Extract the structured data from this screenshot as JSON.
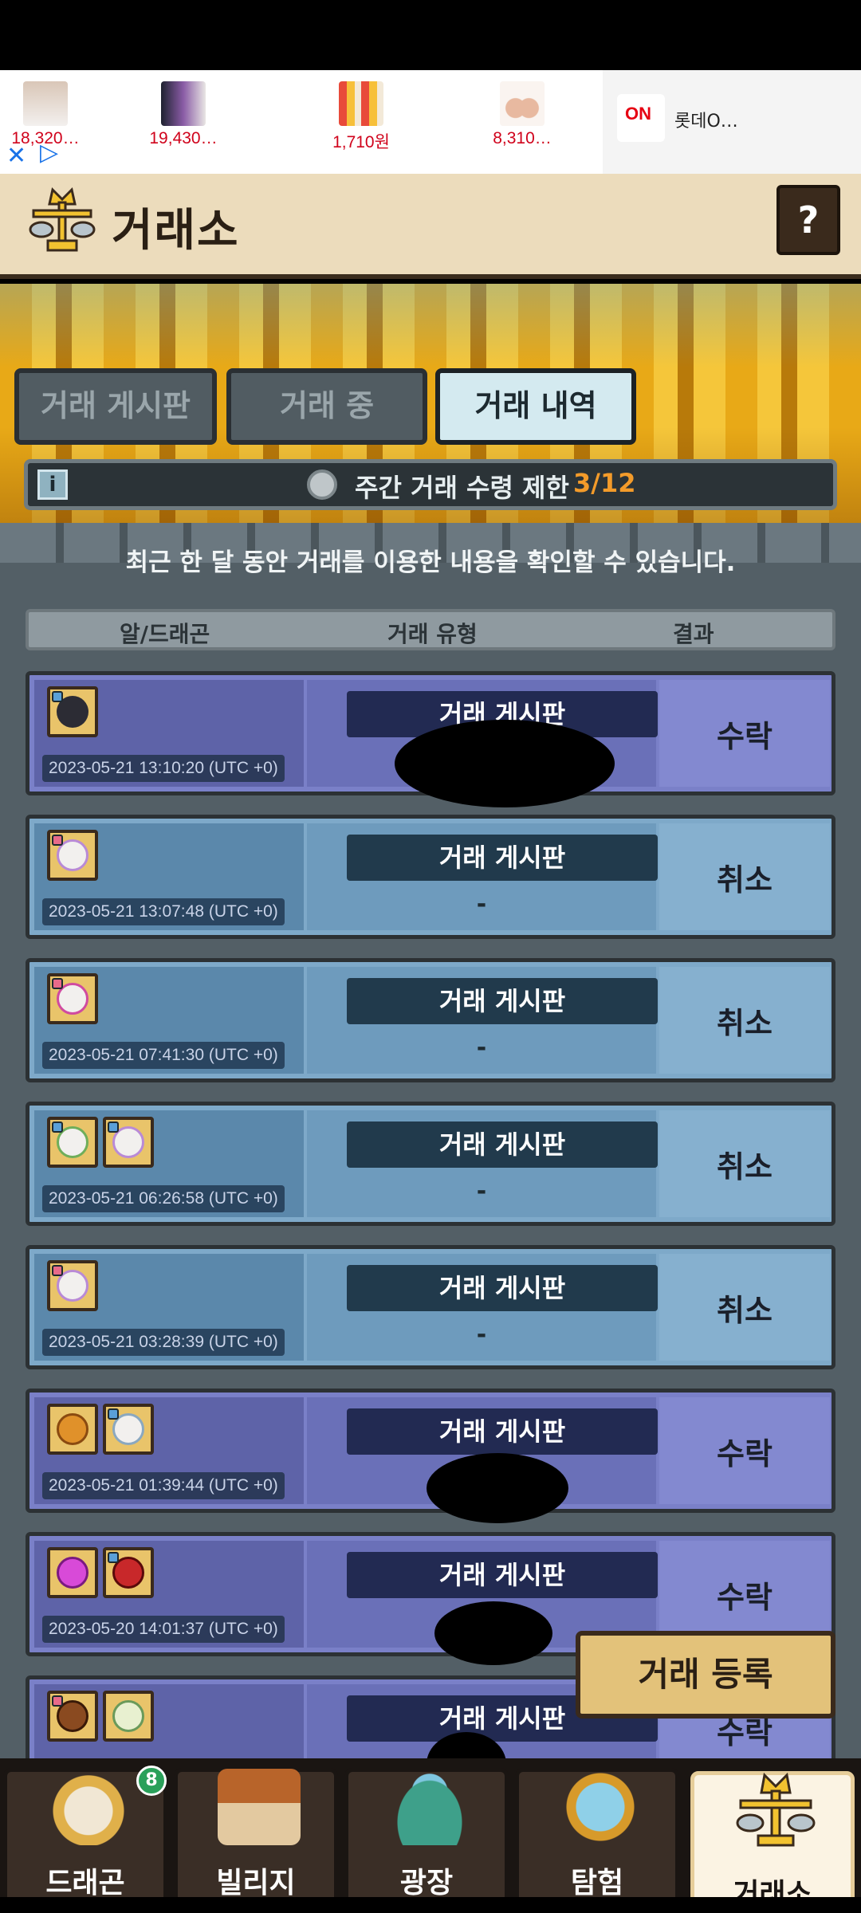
{
  "ad": {
    "prices": [
      "18,320…",
      "19,430…",
      "1,710원",
      "8,310…"
    ],
    "brand_logo": "ON",
    "brand_text": "롯데O…",
    "close_icon": "✕",
    "play_icon": "▷"
  },
  "header": {
    "title": "거래소",
    "help_label": "?"
  },
  "tabs": [
    {
      "label": "거래 게시판",
      "active": false
    },
    {
      "label": "거래 중",
      "active": false
    },
    {
      "label": "거래 내역",
      "active": true
    }
  ],
  "info": {
    "icon_label": "i",
    "text": "주간 거래 수령 제한",
    "count": "3/12"
  },
  "subtitle": "최근 한 달 동안 거래를 이용한 내용을 확인할 수 있습니다.",
  "columns": {
    "col1": "알/드래곤",
    "col2": "거래 유형",
    "col3": "결과"
  },
  "rows": [
    {
      "timestamp": "2023-05-21 13:10:20 (UTC +0)",
      "type": "거래 게시판",
      "detail": "",
      "result": "수락",
      "status": "accepted"
    },
    {
      "timestamp": "2023-05-21 13:07:48 (UTC +0)",
      "type": "거래 게시판",
      "detail": "-",
      "result": "취소",
      "status": "cancelled"
    },
    {
      "timestamp": "2023-05-21 07:41:30 (UTC +0)",
      "type": "거래 게시판",
      "detail": "-",
      "result": "취소",
      "status": "cancelled"
    },
    {
      "timestamp": "2023-05-21 06:26:58 (UTC +0)",
      "type": "거래 게시판",
      "detail": "-",
      "result": "취소",
      "status": "cancelled"
    },
    {
      "timestamp": "2023-05-21 03:28:39 (UTC +0)",
      "type": "거래 게시판",
      "detail": "-",
      "result": "취소",
      "status": "cancelled"
    },
    {
      "timestamp": "2023-05-21 01:39:44 (UTC +0)",
      "type": "거래 게시판",
      "detail": "",
      "result": "수락",
      "status": "accepted"
    },
    {
      "timestamp": "2023-05-20 14:01:37 (UTC +0)",
      "type": "거래 게시판",
      "detail": "",
      "result": "수락",
      "status": "accepted"
    },
    {
      "timestamp": "",
      "type": "거래 게시판",
      "detail": "",
      "result": "수락",
      "status": "accepted"
    }
  ],
  "register_button": "거래 등록",
  "nav": [
    {
      "label": "드래곤",
      "badge": "8",
      "icon": "dragon-icon"
    },
    {
      "label": "빌리지",
      "badge": "",
      "icon": "village-icon"
    },
    {
      "label": "광장",
      "badge": "",
      "icon": "plaza-icon"
    },
    {
      "label": "탐험",
      "badge": "",
      "icon": "compass-icon"
    },
    {
      "label": "거래소",
      "badge": "",
      "icon": "scales-icon"
    }
  ],
  "colors": {
    "accent_orange": "#f39b2a",
    "accepted_row": "#7a80c8",
    "cancelled_row": "#7ea9c9"
  }
}
